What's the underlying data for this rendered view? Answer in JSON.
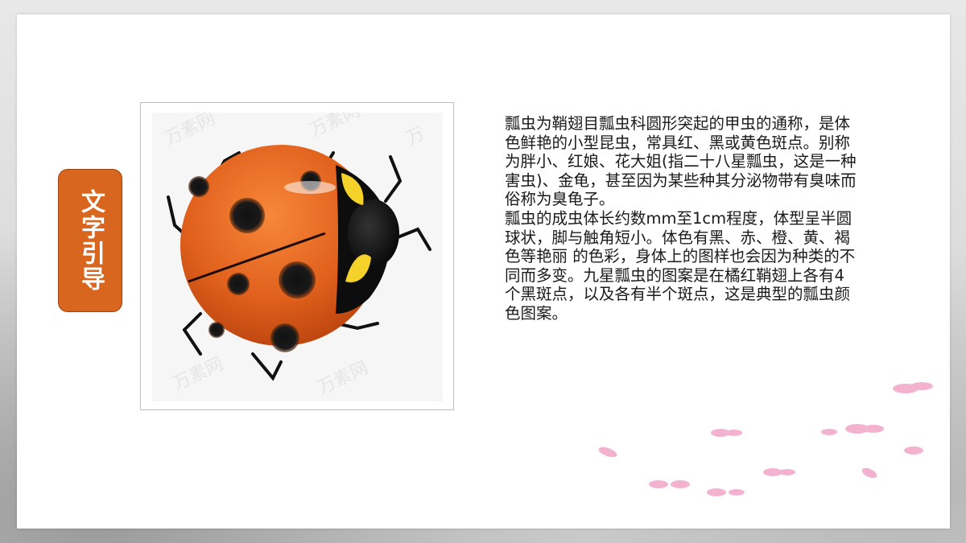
{
  "tag": {
    "label": "文字引导",
    "color": "#d9661f"
  },
  "image": {
    "subject": "ladybug-illustration",
    "watermark": "万素网"
  },
  "description": {
    "paragraphs": [
      "瓢虫为鞘翅目瓢虫科圆形突起的甲虫的通称，是体色鲜艳的小型昆虫，常具红、黑或黄色斑点。别称为胖小、红娘、花大姐(指二十八星瓢虫，这是一种害虫)、金龟，甚至因为某些种其分泌物带有臭味而俗称为臭龟子。",
      "瓢虫的成虫体长约数mm至1cm程度，体型呈半圆球状，脚与触角短小。体色有黑、赤、橙、黄、褐色等艳丽 的色彩，身体上的图样也会因为种类的不同而多变。九星瓢虫的图案是在橘红鞘翅上各有4个黑斑点，以及各有半个斑点，这是典型的瓢虫颜色图案。"
    ]
  },
  "colors": {
    "accent": "#d9661f",
    "ladybug_shell": "#e0601c",
    "petal": "#f2a6c8"
  }
}
